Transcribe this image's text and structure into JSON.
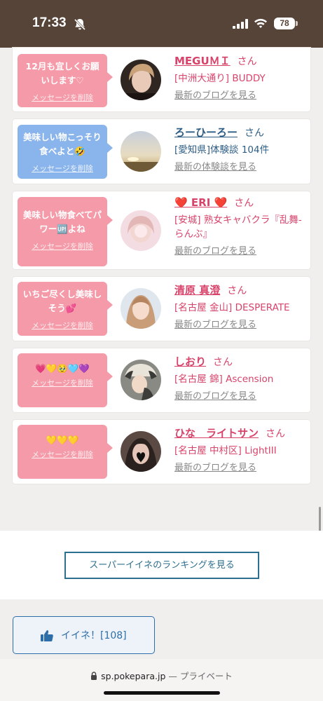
{
  "status_bar": {
    "time": "17:33",
    "battery": "78"
  },
  "messages": [
    {
      "bubble_text": "12月も宜しくお願いします♡",
      "delete_label": "メッセージを削除",
      "bubble_color": "#f59aa8",
      "name": "MEGUＭＩ",
      "san": "さん",
      "shop": "[中洲大通り] BUDDY",
      "blog": "最新のブログを見る",
      "accent": "#d8436a"
    },
    {
      "bubble_text": "美味しい物こっそり食べよと🤣",
      "delete_label": "メッセージを削除",
      "bubble_color": "#8ab4ec",
      "name": "ろーひーろー",
      "san": "さん",
      "shop": "[愛知県]体験談 104件",
      "blog": "最新の体験談を見る",
      "accent": "#2e5e86"
    },
    {
      "bubble_text": "美味しい物食べてパワー🆙よね",
      "delete_label": "メッセージを削除",
      "bubble_color": "#f59aa8",
      "name": "❤️ ERI ❤️",
      "san": "さん",
      "shop": "[安城] 熟女キャバクラ『乱舞-らんぶ』",
      "blog": "最新のブログを見る",
      "accent": "#d8436a"
    },
    {
      "bubble_text": "いちご尽くし美味しそう💕",
      "delete_label": "メッセージを削除",
      "bubble_color": "#f59aa8",
      "name": "清原 真澄",
      "san": "さん",
      "shop": "[名古屋 金山] DESPERATE",
      "blog": "最新のブログを見る",
      "accent": "#d8436a"
    },
    {
      "bubble_text": "💗💛🥹🩵💜",
      "delete_label": "メッセージを削除",
      "bubble_color": "#f59aa8",
      "name": "しおり",
      "san": "さん",
      "shop": "[名古屋 錦] Ascension",
      "blog": "最新のブログを見る",
      "accent": "#d8436a"
    },
    {
      "bubble_text": "💛💛💛",
      "delete_label": "メッセージを削除",
      "bubble_color": "#f59aa8",
      "name": "ひな　ライトサン",
      "san": "さん",
      "shop": "[名古屋 中村区] LightIII",
      "blog": "最新のブログを見る",
      "accent": "#d8436a"
    }
  ],
  "ranking_button": "スーパーイイネのランキングを見る",
  "like_button": {
    "label": "イイネ！[108]"
  },
  "url_bar": {
    "domain": "sp.pokepara.jp",
    "suffix": " — プライベート"
  }
}
